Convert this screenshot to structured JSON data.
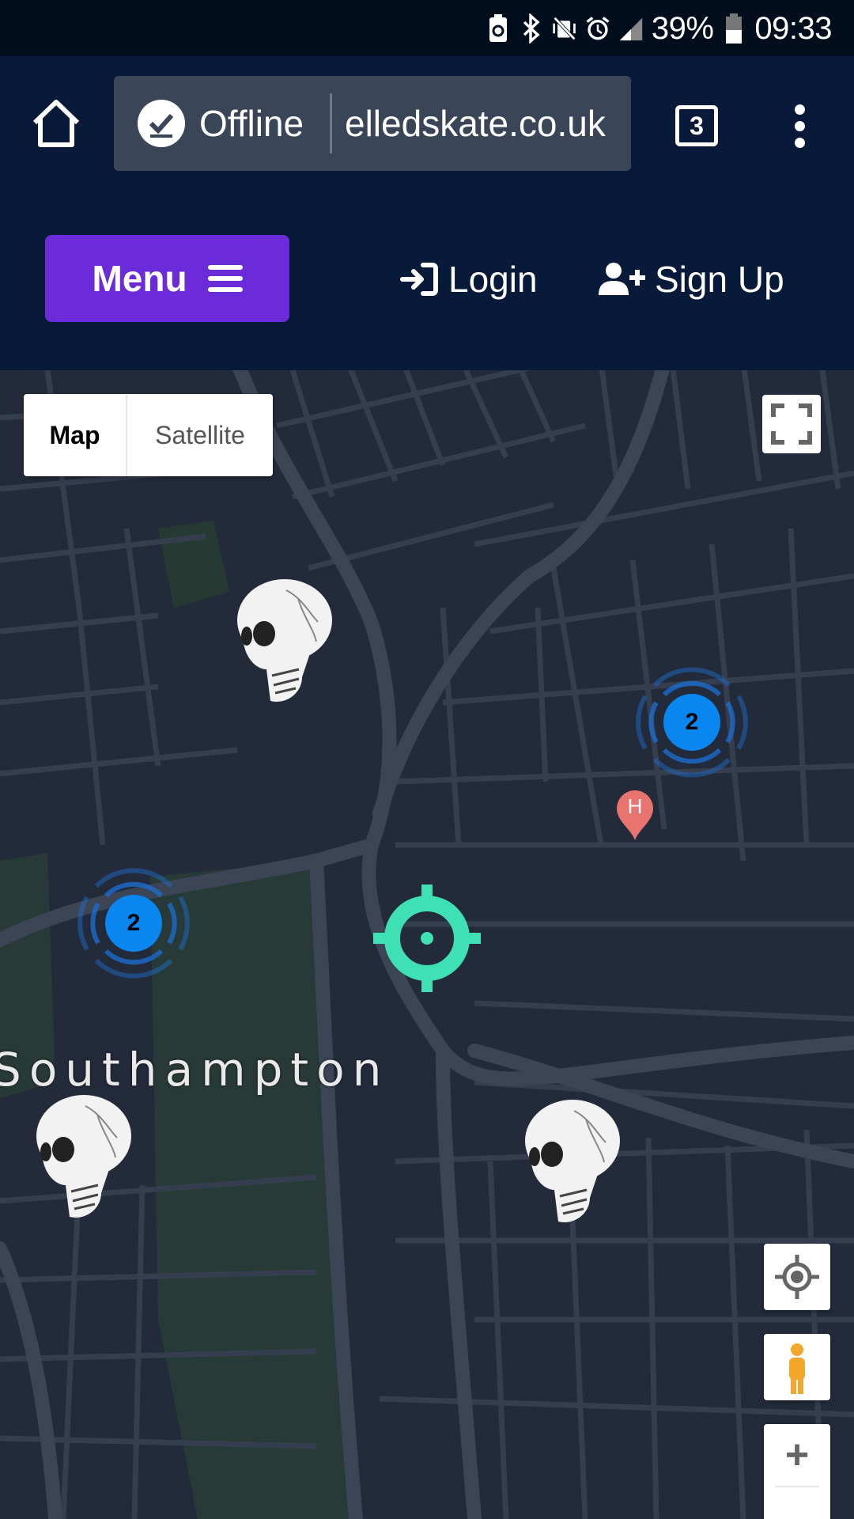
{
  "status_bar": {
    "battery_percent": "39%",
    "time": "09:33",
    "icons": [
      "battery-saver-icon",
      "bluetooth-icon",
      "vibrate-mute-icon",
      "alarm-icon",
      "signal-icon",
      "battery-icon"
    ]
  },
  "browser": {
    "offline_label": "Offline",
    "url_text": "elledskate.co.uk",
    "tab_count": "3"
  },
  "header": {
    "menu_label": "Menu",
    "login_label": "Login",
    "signup_label": "Sign Up",
    "accent_color": "#6b2bd9"
  },
  "map": {
    "map_type_options": [
      "Map",
      "Satellite"
    ],
    "selected_map_type": "Map",
    "city_label": "Southampton",
    "clusters": [
      {
        "count": "2"
      },
      {
        "count": "2"
      }
    ],
    "hospital_marker_label": "H",
    "zoom_in_label": "+"
  }
}
